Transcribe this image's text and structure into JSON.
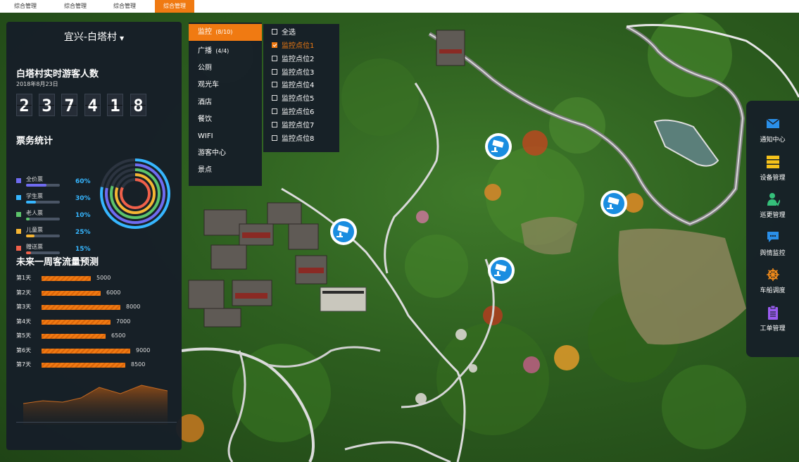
{
  "tabs": [
    "综合管理",
    "综合管理",
    "综合管理",
    "综合管理"
  ],
  "location": {
    "name": "宜兴-白塔村",
    "caret": "▼"
  },
  "visitors": {
    "title": "白塔村实时游客人数",
    "date": "2018年8月23日",
    "digits": [
      "2",
      "3",
      "7",
      "4",
      "1",
      "8"
    ]
  },
  "tickets": {
    "title": "票务统计",
    "items": [
      {
        "name": "全价票",
        "percent": "60%",
        "fill": 0.6,
        "color": "#6f6bf0"
      },
      {
        "name": "学生票",
        "percent": "30%",
        "fill": 0.3,
        "color": "#36b6ff"
      },
      {
        "name": "老人票",
        "percent": "10%",
        "fill": 0.1,
        "color": "#5cc46a"
      },
      {
        "name": "儿童票",
        "percent": "25%",
        "fill": 0.25,
        "color": "#f5b533"
      },
      {
        "name": "赠送票",
        "percent": "15%",
        "fill": 0.15,
        "color": "#f0604a"
      }
    ]
  },
  "forecast": {
    "title": "未来一周客流量预测",
    "days": [
      {
        "label": "第1天",
        "value": 5000
      },
      {
        "label": "第2天",
        "value": 6000
      },
      {
        "label": "第3天",
        "value": 8000
      },
      {
        "label": "第4天",
        "value": 7000
      },
      {
        "label": "第5天",
        "value": 6500
      },
      {
        "label": "第6天",
        "value": 9000
      },
      {
        "label": "第7天",
        "value": 8500
      }
    ]
  },
  "categories": [
    {
      "label": "监控",
      "count": "(8/10)",
      "active": true
    },
    {
      "label": "广播",
      "count": "(4/4)",
      "active": false
    },
    {
      "label": "公厕",
      "count": "",
      "active": false
    },
    {
      "label": "观光车",
      "count": "",
      "active": false
    },
    {
      "label": "酒店",
      "count": "",
      "active": false
    },
    {
      "label": "餐饮",
      "count": "",
      "active": false
    },
    {
      "label": "WIFI",
      "count": "",
      "active": false
    },
    {
      "label": "游客中心",
      "count": "",
      "active": false
    },
    {
      "label": "景点",
      "count": "",
      "active": false
    }
  ],
  "monitors": {
    "select_all": "全选",
    "points": [
      {
        "label": "监控点位1",
        "checked": true
      },
      {
        "label": "监控点位2",
        "checked": false
      },
      {
        "label": "监控点位3",
        "checked": false
      },
      {
        "label": "监控点位4",
        "checked": false
      },
      {
        "label": "监控点位5",
        "checked": false
      },
      {
        "label": "监控点位6",
        "checked": false
      },
      {
        "label": "监控点位7",
        "checked": false
      },
      {
        "label": "监控点位8",
        "checked": false
      }
    ]
  },
  "tools": [
    {
      "label": "通知中心",
      "icon": "mail-icon",
      "color": "#2a8fe8"
    },
    {
      "label": "设备管理",
      "icon": "server-icon",
      "color": "#f5c21b"
    },
    {
      "label": "巡更管理",
      "icon": "patrol-person-icon",
      "color": "#35c07a"
    },
    {
      "label": "舆情监控",
      "icon": "chat-icon",
      "color": "#2a8fe8"
    },
    {
      "label": "车船调度",
      "icon": "ship-wheel-icon",
      "color": "#f08a1a"
    },
    {
      "label": "工单管理",
      "icon": "clipboard-icon",
      "color": "#9a5cf0"
    }
  ],
  "chart_data": {
    "type": "bar",
    "categories": [
      "第1天",
      "第2天",
      "第3天",
      "第4天",
      "第5天",
      "第6天",
      "第7天"
    ],
    "values": [
      5000,
      6000,
      8000,
      7000,
      6500,
      9000,
      8500
    ],
    "title": "未来一周客流量预测"
  }
}
